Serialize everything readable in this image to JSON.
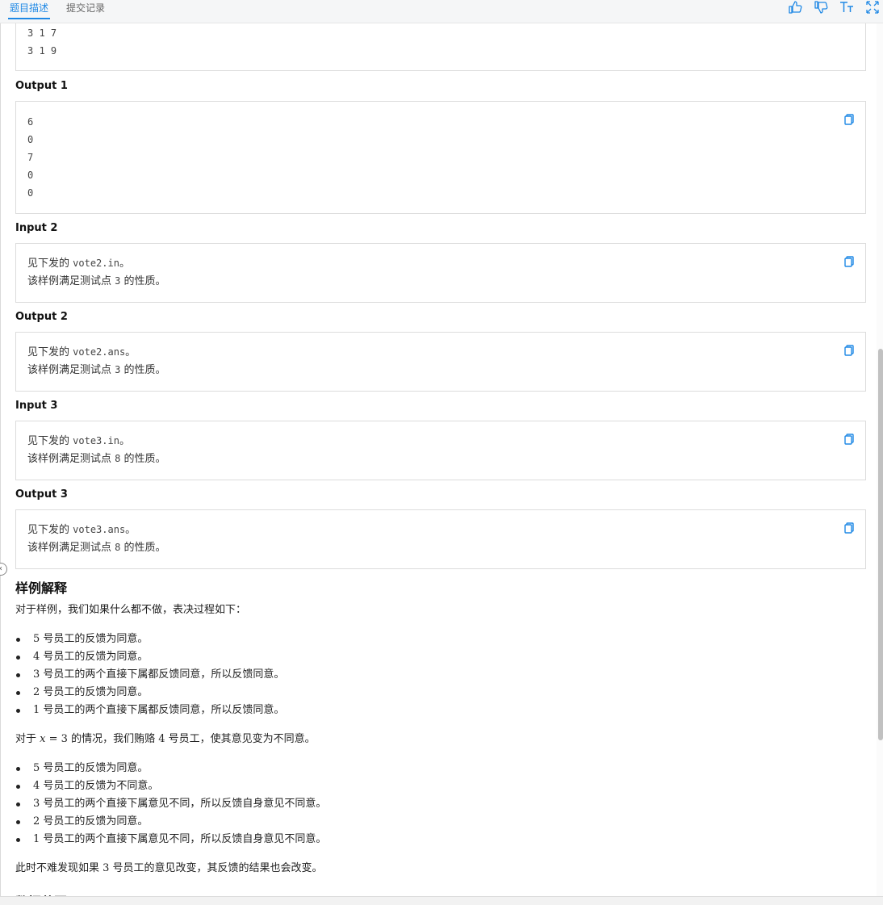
{
  "tabs": {
    "problem": "题目描述",
    "submissions": "提交记录"
  },
  "toolbar_icons": [
    "thumbs-up-icon",
    "thumbs-down-icon",
    "font-size-icon",
    "fullscreen-icon"
  ],
  "accent_color": "#1e88e5",
  "input1_tail": [
    "3 1 7",
    "3 1 9"
  ],
  "output1": {
    "label": "Output 1",
    "lines": [
      "6",
      "0",
      "7",
      "0",
      "0"
    ]
  },
  "input2": {
    "label": "Input 2",
    "line1_pre": "见下发的 ",
    "line1_code": "vote2.in",
    "line1_post": "。",
    "line2_pre": "该样例满足测试点 ",
    "line2_code": "3",
    "line2_post": " 的性质。"
  },
  "output2": {
    "label": "Output 2",
    "line1_pre": "见下发的 ",
    "line1_code": "vote2.ans",
    "line1_post": "。",
    "line2_pre": "该样例满足测试点 ",
    "line2_code": "3",
    "line2_post": " 的性质。"
  },
  "input3": {
    "label": "Input 3",
    "line1_pre": "见下发的 ",
    "line1_code": "vote3.in",
    "line1_post": "。",
    "line2_pre": "该样例满足测试点 ",
    "line2_code": "8",
    "line2_post": " 的性质。"
  },
  "output3": {
    "label": "Output 3",
    "line1_pre": "见下发的 ",
    "line1_code": "vote3.ans",
    "line1_post": "。",
    "line2_pre": "该样例满足测试点 ",
    "line2_code": "8",
    "line2_post": " 的性质。"
  },
  "explanation": {
    "title": "样例解释",
    "intro": "对于样例，我们如果什么都不做，表决过程如下：",
    "list1": [
      {
        "num": "5",
        "text": " 号员工的反馈为同意。"
      },
      {
        "num": "4",
        "text": " 号员工的反馈为同意。"
      },
      {
        "num": "3",
        "text": " 号员工的两个直接下属都反馈同意，所以反馈同意。"
      },
      {
        "num": "2",
        "text": " 号员工的反馈为同意。"
      },
      {
        "num": "1",
        "text": " 号员工的两个直接下属都反馈同意，所以反馈同意。"
      }
    ],
    "mid_pre": "对于 ",
    "mid_var": "x",
    "mid_eq": " = ",
    "mid_num": "3",
    "mid_text": " 的情况，我们贿赂 ",
    "mid_num2": "4",
    "mid_post": " 号员工，使其意见变为不同意。",
    "list2": [
      {
        "num": "5",
        "text": " 号员工的反馈为同意。"
      },
      {
        "num": "4",
        "text": " 号员工的反馈为不同意。"
      },
      {
        "num": "3",
        "text": " 号员工的两个直接下属意见不同，所以反馈自身意见不同意。"
      },
      {
        "num": "2",
        "text": " 号员工的反馈为同意。"
      },
      {
        "num": "1",
        "text": " 号员工的两个直接下属意见不同，所以反馈自身意见不同意。"
      }
    ],
    "outro_pre": "此时不难发现如果 ",
    "outro_num": "3",
    "outro_post": " 号员工的意见改变，其反馈的结果也会改变。",
    "next_title": "数据范围"
  }
}
